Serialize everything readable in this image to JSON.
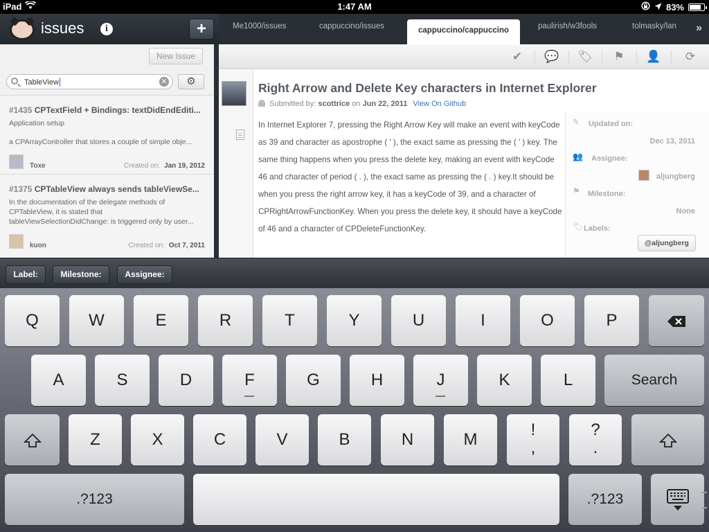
{
  "status": {
    "device": "iPad",
    "time": "1:47 AM",
    "battery": "83%"
  },
  "sidebar": {
    "app_title": "issues",
    "new_issue_label": "New Issue",
    "search": {
      "value": "TableView"
    },
    "issues": [
      {
        "number": "#1435",
        "title": "CPTextField + Bindings: textDidEndEditi...",
        "lines": [
          "Application setup",
          "a CPArrayController that stores a couple of simple obje..."
        ],
        "user": "Toxe",
        "created_label": "Created on:",
        "created": "Jan 19, 2012"
      },
      {
        "number": "#1375",
        "title": "CPTableView always sends tableViewSe...",
        "lines": [
          "In the documentation of the delegate methods of",
          "CPTableView, it is stated that",
          "tableViewSelectionDidChange: is triggered only by user..."
        ],
        "user": "kuon",
        "created_label": "Created on:",
        "created": "Oct 7, 2011"
      }
    ]
  },
  "tabs": [
    "Me1000/issues",
    "cappuccino/issues",
    "cappuccino/cappuccino",
    "paulirish/w3fools",
    "tolmasky/lan"
  ],
  "active_tab": 2,
  "issue": {
    "title": "Right Arrow and Delete Key characters in Internet Explorer",
    "submitted_label": "Submitted by:",
    "submitter": "scottrice",
    "on_label": "on",
    "date": "Jun 22, 2011",
    "github_link": "View On Github",
    "body": "In Internet Explorer 7, pressing the Right Arrow Key will make an event with keyCode as 39 and character as apostrophe ( ' ), the exact same as pressing the ( ' ) key. The same thing happens when you press the delete key, making an event with keyCode 46 and character of period ( . ), the exact same as pressing the ( . ) key.It should be when you press the right arrow key, it has a keyCode of 39, and a character of CPRightArrowFunctionKey. When you press the delete key, it should have a keyCode of 46 and a character of CPDeleteFunctionKey.",
    "updated_label": "Updated on:",
    "updated": "Dec 13, 2011",
    "assignee_label": "Assignee:",
    "assignee": "aljungberg",
    "milestone_label": "Milestone:",
    "milestone": "None",
    "labels_label": "Labels:",
    "label_chip": "@aljungberg"
  },
  "accessory": {
    "label": "Label:",
    "milestone": "Milestone:",
    "assignee": "Assignee:"
  },
  "keyboard": {
    "row1": [
      "Q",
      "W",
      "E",
      "R",
      "T",
      "Y",
      "U",
      "I",
      "O",
      "P"
    ],
    "row2": [
      "A",
      "S",
      "D",
      "F",
      "G",
      "H",
      "J",
      "K",
      "L"
    ],
    "search": "Search",
    "row3": [
      "Z",
      "X",
      "C",
      "V",
      "B",
      "N",
      "M"
    ],
    "punct1": [
      "!",
      ","
    ],
    "punct2": [
      "?",
      "."
    ],
    "numbers": ".?123"
  }
}
